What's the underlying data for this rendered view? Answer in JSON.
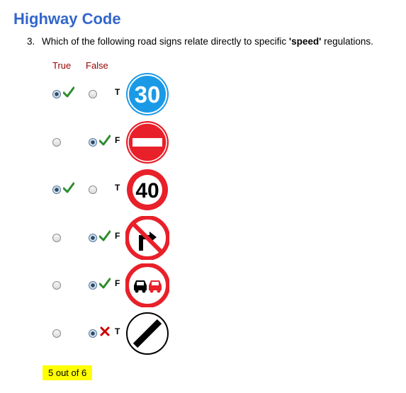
{
  "page": {
    "title": "Highway Code"
  },
  "question": {
    "number": "3.",
    "text_before": "Which of the following road signs relate directly to specific ",
    "text_bold": "'speed'",
    "text_after": " regulations."
  },
  "columns": {
    "true_label": "True",
    "false_label": "False"
  },
  "rows": [
    {
      "sign": "speed-limit-30",
      "sign_text": "30",
      "selected": "true",
      "mark": "tick",
      "answer": "T"
    },
    {
      "sign": "no-entry",
      "sign_text": "",
      "selected": "false",
      "mark": "tick",
      "answer": "F"
    },
    {
      "sign": "speed-limit-40",
      "sign_text": "40",
      "selected": "true",
      "mark": "tick",
      "answer": "T"
    },
    {
      "sign": "no-right-turn",
      "sign_text": "",
      "selected": "false",
      "mark": "tick",
      "answer": "F"
    },
    {
      "sign": "no-overtaking",
      "sign_text": "",
      "selected": "false",
      "mark": "tick",
      "answer": "F"
    },
    {
      "sign": "national-speed-limit",
      "sign_text": "",
      "selected": "false",
      "mark": "cross",
      "answer": "T"
    }
  ],
  "score": {
    "text": "5 out of 6"
  },
  "colors": {
    "title": "#3366cc",
    "column_header": "#990000",
    "tick": "#2e8b2e",
    "cross": "#cc0000",
    "sign_red": "#e8202a",
    "sign_blue": "#1a9ae6",
    "score_highlight": "#ffff00"
  }
}
